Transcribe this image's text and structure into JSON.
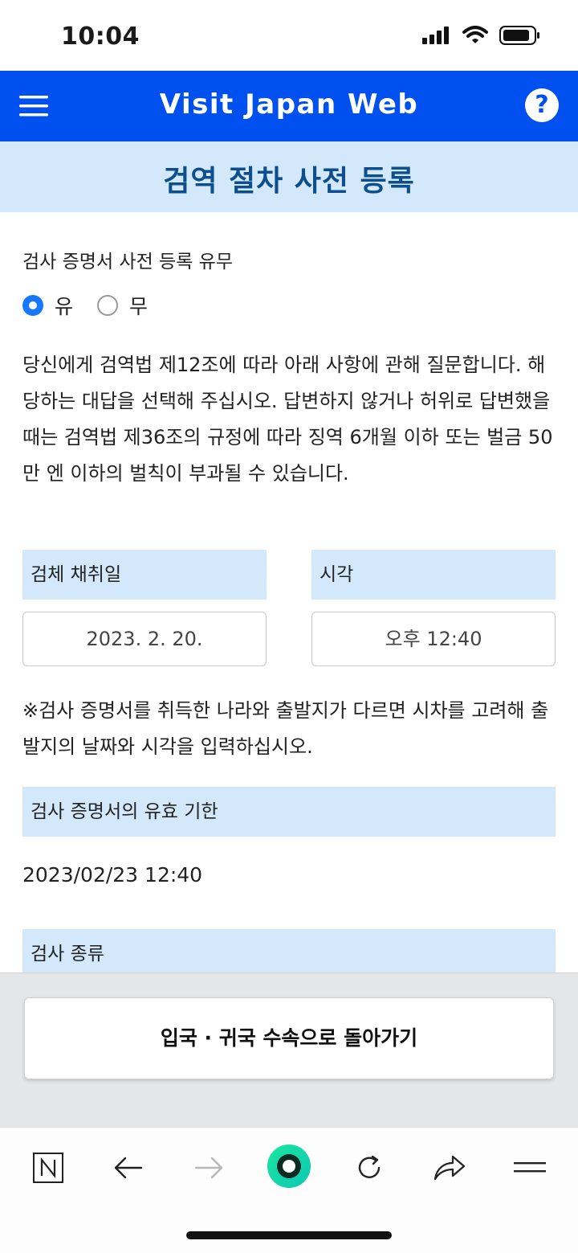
{
  "status_bar": {
    "time": "10:04"
  },
  "header": {
    "title": "Visit Japan Web"
  },
  "page": {
    "title": "검역 절차 사전 등록"
  },
  "form": {
    "certificate_question": "검사 증명서 사전 등록 유무",
    "radio_yes": "유",
    "radio_no": "무",
    "notice": "당신에게 검역법 제12조에 따라 아래 사항에 관해 질문합니다. 해당하는 대답을 선택해 주십시오. 답변하지 않거나 허위로 답변했을 때는 검역법 제36조의 규정에 따라 징역 6개월 이하 또는 벌금 50만 엔 이하의 벌칙이 부과될 수 있습니다.",
    "sample_date_label": "검체 채취일",
    "sample_date_value": "2023. 2. 20.",
    "time_label": "시각",
    "time_value": "오후 12:40",
    "note": "※검사 증명서를 취득한 나라와 출발지가 다르면 시차를 고려해 출발지의 날짜와 시각을 입력하십시오.",
    "validity_label": "검사 증명서의 유효 기한",
    "validity_value": "2023/02/23 12:40",
    "test_type_label": "검사 종류"
  },
  "footer": {
    "return_button": "입국 · 귀국 수속으로 돌아가기"
  },
  "browser_toolbar": {
    "icons": [
      "naver-n-icon",
      "back-arrow-icon",
      "forward-arrow-icon",
      "home-green-icon",
      "refresh-icon",
      "share-icon",
      "menu-lines-icon"
    ]
  },
  "colors": {
    "header_blue": "#0050f0",
    "banner_light_blue": "#d3e9fb",
    "title_dark_blue": "#0d4f8c",
    "radio_blue": "#1677ff",
    "green_button": "#1fd98a"
  }
}
